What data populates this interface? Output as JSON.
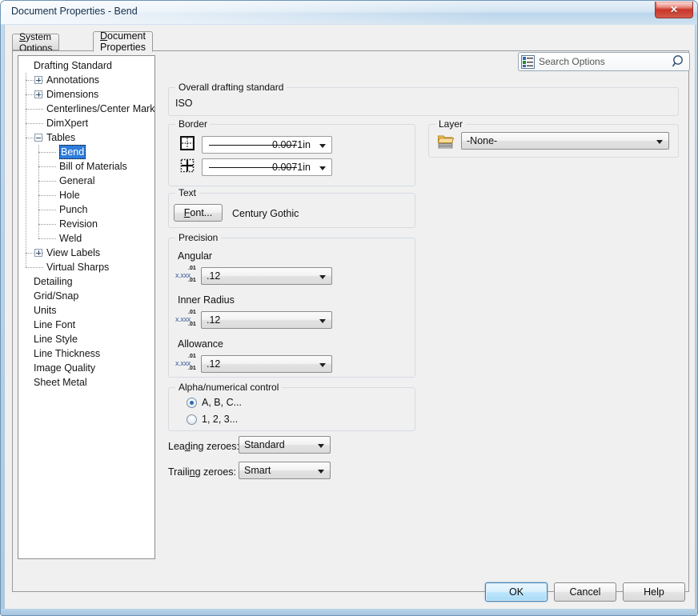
{
  "window": {
    "title": "Document Properties - Bend",
    "close_label": "Close"
  },
  "tabs": [
    {
      "label": "System Options",
      "active": false
    },
    {
      "label": "Document Properties",
      "active": true
    }
  ],
  "search": {
    "placeholder": "Search Options",
    "icon": "search-options-icon",
    "magnifier": "magnifier-icon"
  },
  "tree": {
    "items": [
      {
        "label": "Drafting Standard",
        "depth": 0,
        "expander": "none",
        "selected": false
      },
      {
        "label": "Annotations",
        "depth": 1,
        "expander": "plus",
        "selected": false
      },
      {
        "label": "Dimensions",
        "depth": 1,
        "expander": "plus",
        "selected": false
      },
      {
        "label": "Centerlines/Center Marks",
        "depth": 1,
        "expander": "none",
        "selected": false
      },
      {
        "label": "DimXpert",
        "depth": 1,
        "expander": "none",
        "selected": false
      },
      {
        "label": "Tables",
        "depth": 1,
        "expander": "minus",
        "selected": false
      },
      {
        "label": "Bend",
        "depth": 2,
        "expander": "none",
        "selected": true
      },
      {
        "label": "Bill of Materials",
        "depth": 2,
        "expander": "none",
        "selected": false
      },
      {
        "label": "General",
        "depth": 2,
        "expander": "none",
        "selected": false
      },
      {
        "label": "Hole",
        "depth": 2,
        "expander": "none",
        "selected": false
      },
      {
        "label": "Punch",
        "depth": 2,
        "expander": "none",
        "selected": false
      },
      {
        "label": "Revision",
        "depth": 2,
        "expander": "none",
        "selected": false
      },
      {
        "label": "Weld",
        "depth": 2,
        "expander": "none",
        "selected": false
      },
      {
        "label": "View Labels",
        "depth": 1,
        "expander": "plus",
        "selected": false
      },
      {
        "label": "Virtual Sharps",
        "depth": 1,
        "expander": "none",
        "selected": false
      },
      {
        "label": "Detailing",
        "depth": 0,
        "expander": "none",
        "selected": false
      },
      {
        "label": "Grid/Snap",
        "depth": 0,
        "expander": "none",
        "selected": false
      },
      {
        "label": "Units",
        "depth": 0,
        "expander": "none",
        "selected": false
      },
      {
        "label": "Line Font",
        "depth": 0,
        "expander": "none",
        "selected": false
      },
      {
        "label": "Line Style",
        "depth": 0,
        "expander": "none",
        "selected": false
      },
      {
        "label": "Line Thickness",
        "depth": 0,
        "expander": "none",
        "selected": false
      },
      {
        "label": "Image Quality",
        "depth": 0,
        "expander": "none",
        "selected": false
      },
      {
        "label": "Sheet Metal",
        "depth": 0,
        "expander": "none",
        "selected": false
      }
    ]
  },
  "overall": {
    "group_label": "Overall drafting standard",
    "value": "ISO"
  },
  "border": {
    "group_label": "Border",
    "rows": [
      {
        "icon": "outer-border-icon",
        "value": "0.0071in"
      },
      {
        "icon": "inner-grid-icon",
        "value": "0.0071in"
      }
    ]
  },
  "text_section": {
    "group_label": "Text",
    "font_button": "Font...",
    "font_name": "Century Gothic"
  },
  "precision": {
    "group_label": "Precision",
    "rows": [
      {
        "label": "Angular",
        "value": ".12",
        "icon": "precision-icon"
      },
      {
        "label": "Inner Radius",
        "value": ".12",
        "icon": "precision-icon"
      },
      {
        "label": "Allowance",
        "value": ".12",
        "icon": "precision-icon"
      }
    ],
    "icon_text": {
      "main": "x.xxx",
      "upper": ".01",
      "lower": ".01"
    }
  },
  "alpha": {
    "group_label": "Alpha/numerical control",
    "options": [
      {
        "label": "A, B, C...",
        "selected": true
      },
      {
        "label": "1, 2, 3...",
        "selected": false
      }
    ]
  },
  "zeroes": {
    "leading_label": "Leading zeroes:",
    "leading_value": "Standard",
    "trailing_label": "Trailing zeroes:",
    "trailing_value": "Smart"
  },
  "layer": {
    "group_label": "Layer",
    "icon": "layers-folder-icon",
    "value": "-None-"
  },
  "footer": {
    "ok": "OK",
    "cancel": "Cancel",
    "help": "Help"
  },
  "colors": {
    "selection_blue": "#2f7ddb",
    "titlebar_text": "#0f2c4d",
    "close_red": "#c8372b",
    "precision_icon_blue": "#3a5f99",
    "folder_yellow": "#e8b341"
  }
}
